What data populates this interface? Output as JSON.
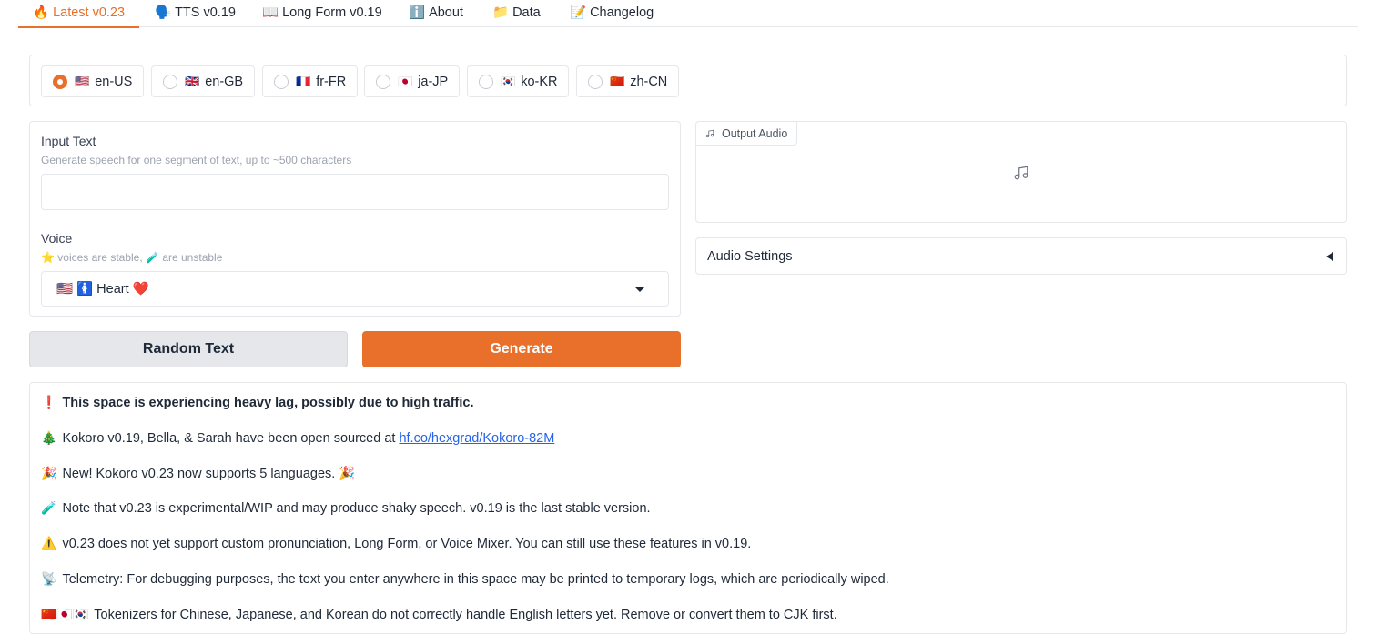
{
  "tabs": [
    {
      "icon": "🔥",
      "label": "Latest v0.23",
      "active": true
    },
    {
      "icon": "🗣️",
      "label": "TTS v0.19"
    },
    {
      "icon": "📖",
      "label": "Long Form v0.19"
    },
    {
      "icon": "ℹ️",
      "label": "About"
    },
    {
      "icon": "📁",
      "label": "Data"
    },
    {
      "icon": "📝",
      "label": "Changelog"
    }
  ],
  "languages": [
    {
      "flag": "🇺🇸",
      "label": "en-US",
      "selected": true
    },
    {
      "flag": "🇬🇧",
      "label": "en-GB"
    },
    {
      "flag": "🇫🇷",
      "label": "fr-FR"
    },
    {
      "flag": "🇯🇵",
      "label": "ja-JP"
    },
    {
      "flag": "🇰🇷",
      "label": "ko-KR"
    },
    {
      "flag": "🇨🇳",
      "label": "zh-CN"
    }
  ],
  "input": {
    "label": "Input Text",
    "info": "Generate speech for one segment of text, up to ~500 characters",
    "value": ""
  },
  "voice": {
    "label": "Voice",
    "info_star": "⭐",
    "info_text1": "voices are stable,",
    "info_tube": "🧪",
    "info_text2": "are unstable",
    "selected": "🇺🇸 🚺 Heart ❤️"
  },
  "buttons": {
    "random": "Random Text",
    "generate": "Generate"
  },
  "output": {
    "label": "Output Audio"
  },
  "settings": {
    "label": "Audio Settings"
  },
  "notes": {
    "lag": {
      "icon": "❗",
      "text": "This space is experiencing heavy lag, possibly due to high traffic."
    },
    "open_source": {
      "icon": "🎄",
      "text": "Kokoro v0.19, Bella, & Sarah have been open sourced at",
      "link": "hf.co/hexgrad/Kokoro-82M"
    },
    "languages": {
      "icon": "🎉",
      "text": "New! Kokoro v0.23 now supports 5 languages.",
      "icon_end": "🎉"
    },
    "experimental": {
      "icon": "🧪",
      "text": "Note that v0.23 is experimental/WIP and may produce shaky speech. v0.19 is the last stable version."
    },
    "unsupported": {
      "icon": "⚠️",
      "text": "v0.23 does not yet support custom pronunciation, Long Form, or Voice Mixer. You can still use these features in v0.19."
    },
    "telemetry": {
      "icon": "📡",
      "text": "Telemetry: For debugging purposes, the text you enter anywhere in this space may be printed to temporary logs, which are periodically wiped."
    },
    "tokenizers": {
      "icon": "🇨🇳🇯🇵🇰🇷",
      "text": "Tokenizers for Chinese, Japanese, and Korean do not correctly handle English letters yet. Remove or convert them to CJK first."
    }
  },
  "colors": {
    "accent": "#e8702a",
    "border": "#e5e7eb",
    "link": "#2563eb"
  }
}
